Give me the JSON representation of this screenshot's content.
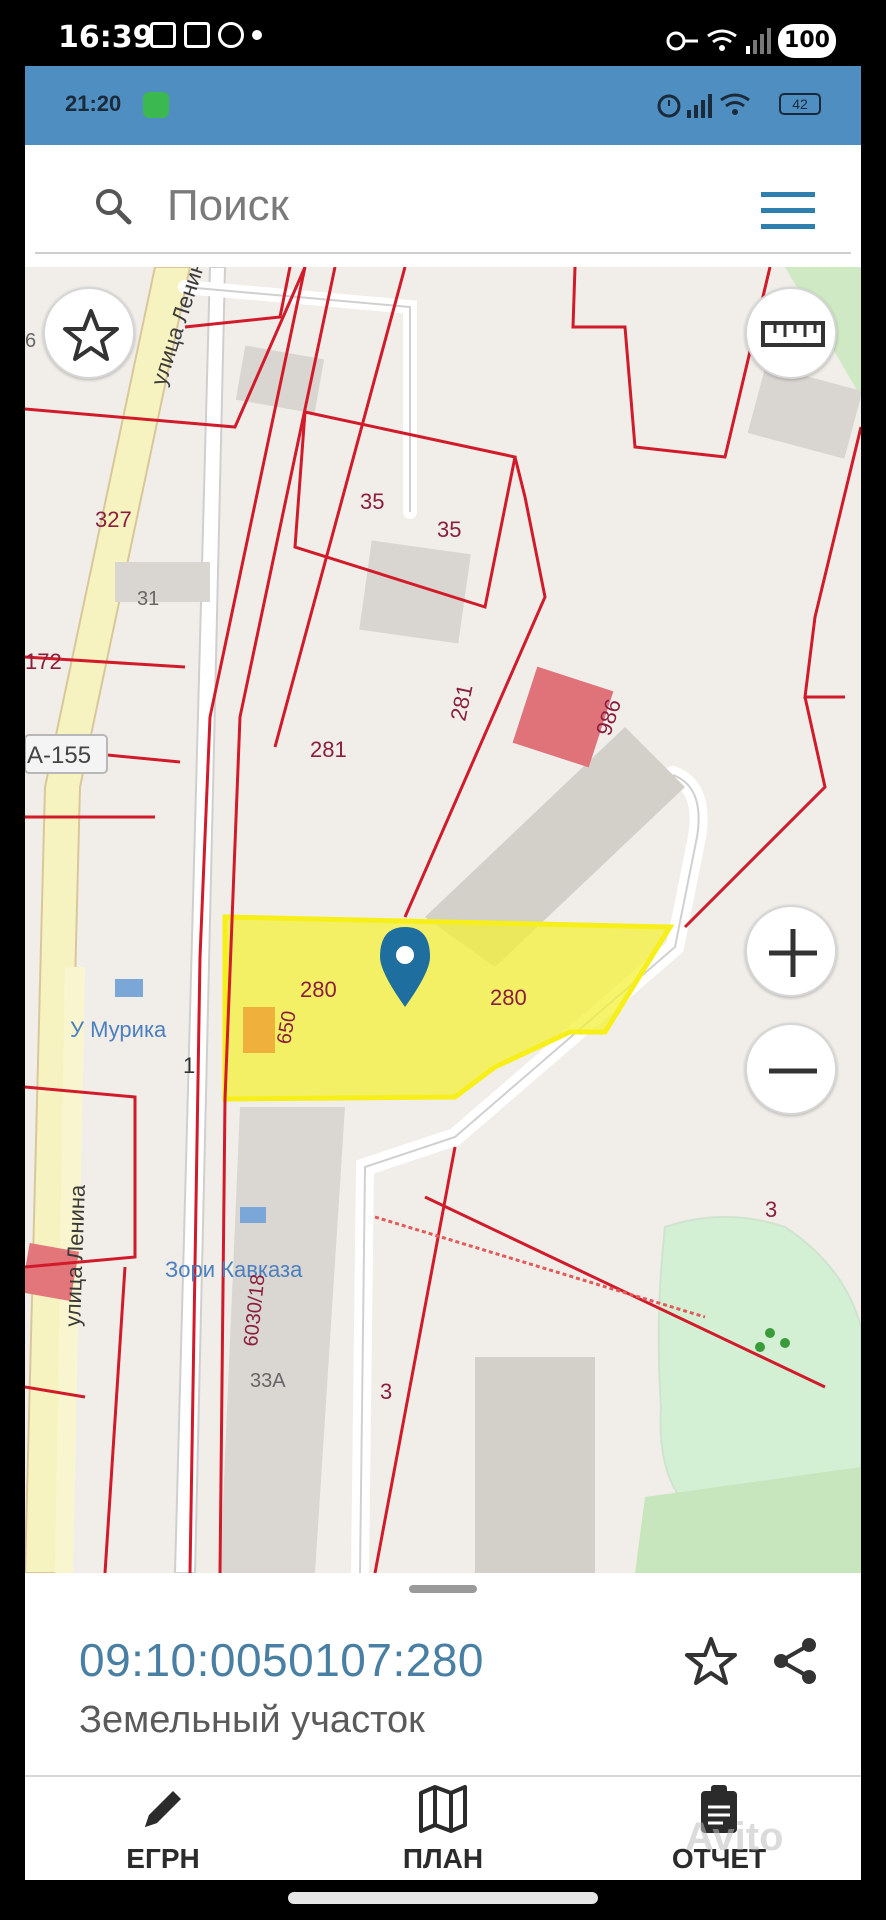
{
  "outer_status": {
    "time": "16:39",
    "battery": "100"
  },
  "inner_status": {
    "time": "21:20",
    "battery": "42"
  },
  "search": {
    "placeholder": "Поиск"
  },
  "map": {
    "labels": {
      "street_top": "улица Ленина",
      "street_bottom": "улица Ленина",
      "n327": "327",
      "n31": "31",
      "n172": "172",
      "road": "А-155",
      "n35a": "35",
      "n35b": "35",
      "n281a": "281",
      "n281b": "281",
      "n986": "986",
      "n280a": "280",
      "n280b": "280",
      "n650": "650",
      "poi_murika": "У Мурика",
      "n1": "1",
      "poi_zori": "Зори Кавказа",
      "n6030": "6030/18",
      "n33a": "33А",
      "n3a": "3",
      "n3b": "3",
      "n6": "6"
    }
  },
  "sheet": {
    "parcel_number": "09:10:0050107:280",
    "parcel_type": "Земельный участок"
  },
  "nav": {
    "egrn": "ЕГРН",
    "plan": "ПЛАН",
    "report": "ОТЧЕТ"
  },
  "watermark": "Avito",
  "colors": {
    "accent": "#4e8ec0",
    "parcel_highlight": "#f3f03a",
    "boundary": "#d11b2b",
    "parcel_number_text": "#4a7fa4"
  }
}
